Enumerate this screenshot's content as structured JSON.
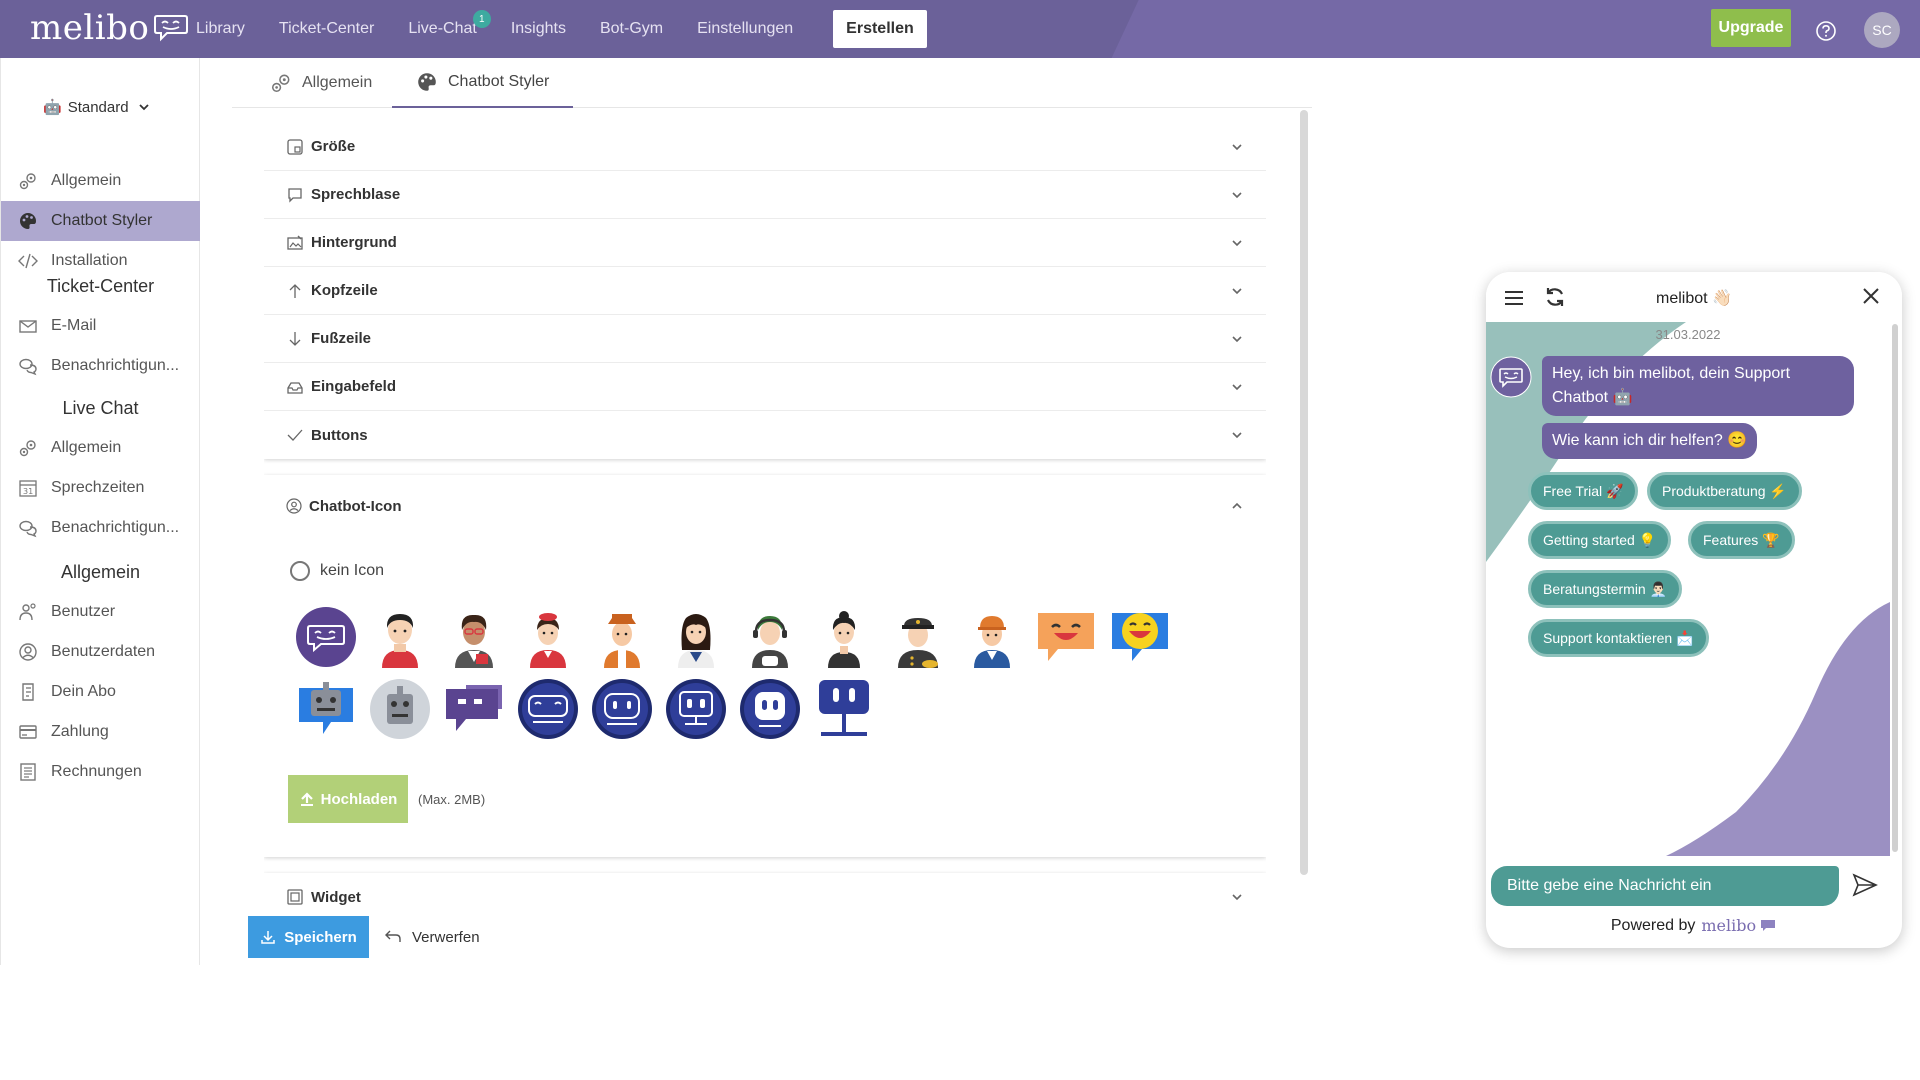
{
  "app": {
    "logo_text": "melibo",
    "nav": [
      "Library",
      "Ticket-Center",
      "Live-Chat",
      "Insights",
      "Bot-Gym",
      "Einstellungen"
    ],
    "live_chat_badge": "1",
    "create_label": "Erstellen",
    "upgrade_label": "Upgrade",
    "avatar_initials": "SC"
  },
  "sidebar": {
    "bot_selector": {
      "emoji": "🤖",
      "label": "Standard"
    },
    "section1": [
      {
        "label": "Allgemein",
        "icon": "gears-icon"
      },
      {
        "label": "Chatbot Styler",
        "icon": "palette-icon",
        "active": true
      },
      {
        "label": "Installation",
        "icon": "code-icon"
      }
    ],
    "heading_ticket": "Ticket-Center",
    "section_ticket": [
      {
        "label": "E-Mail",
        "icon": "mail-icon"
      },
      {
        "label": "Benachrichtigun...",
        "icon": "chat-bubbles-icon"
      }
    ],
    "heading_live": "Live Chat",
    "section_live": [
      {
        "label": "Allgemein",
        "icon": "gears-icon"
      },
      {
        "label": "Sprechzeiten",
        "icon": "calendar-icon"
      },
      {
        "label": "Benachrichtigun...",
        "icon": "chat-bubbles-icon"
      }
    ],
    "heading_general": "Allgemein",
    "section_general": [
      {
        "label": "Benutzer",
        "icon": "users-icon"
      },
      {
        "label": "Benutzerdaten",
        "icon": "user-data-icon"
      },
      {
        "label": "Dein Abo",
        "icon": "subscription-icon"
      },
      {
        "label": "Zahlung",
        "icon": "credit-card-icon"
      },
      {
        "label": "Rechnungen",
        "icon": "invoice-icon"
      }
    ]
  },
  "tabs": [
    {
      "label": "Allgemein"
    },
    {
      "label": "Chatbot Styler",
      "active": true
    }
  ],
  "accordion": [
    {
      "label": "Größe",
      "icon": "size-icon"
    },
    {
      "label": "Sprechblase",
      "icon": "speech-bubble-icon"
    },
    {
      "label": "Hintergrund",
      "icon": "background-icon"
    },
    {
      "label": "Kopfzeile",
      "icon": "arrow-up-icon"
    },
    {
      "label": "Fußzeile",
      "icon": "arrow-down-icon"
    },
    {
      "label": "Eingabefeld",
      "icon": "input-field-icon"
    },
    {
      "label": "Buttons",
      "icon": "checkmark-icon"
    }
  ],
  "chatbot_icon": {
    "title": "Chatbot-Icon",
    "no_icon_label": "kein Icon",
    "upload_label": "Hochladen",
    "upload_hint": "(Max. 2MB)"
  },
  "widget_section": {
    "label": "Widget"
  },
  "actions": {
    "save_label": "Speichern",
    "discard_label": "Verwerfen"
  },
  "chat_preview": {
    "title": "melibot 👋🏻",
    "date": "31.03.2022",
    "messages": [
      "Hey, ich bin melibot, dein Support Chatbot 🤖",
      "Wie kann ich dir helfen? 😊"
    ],
    "quick_replies": [
      "Free Trial 🚀",
      "Produktberatung ⚡",
      "Getting started 💡",
      "Features 🏆",
      "Beratungstermin 👨🏻‍💼",
      "Support kontaktieren 📩"
    ],
    "input_placeholder": "Bitte gebe eine Nachricht ein",
    "powered_by": "Powered by",
    "powered_brand": "melibo"
  },
  "colors": {
    "brand_purple": "#6b6199",
    "accent_green": "#8fbe4c",
    "teal": "#4e9b94",
    "save_blue": "#3d9be0"
  }
}
